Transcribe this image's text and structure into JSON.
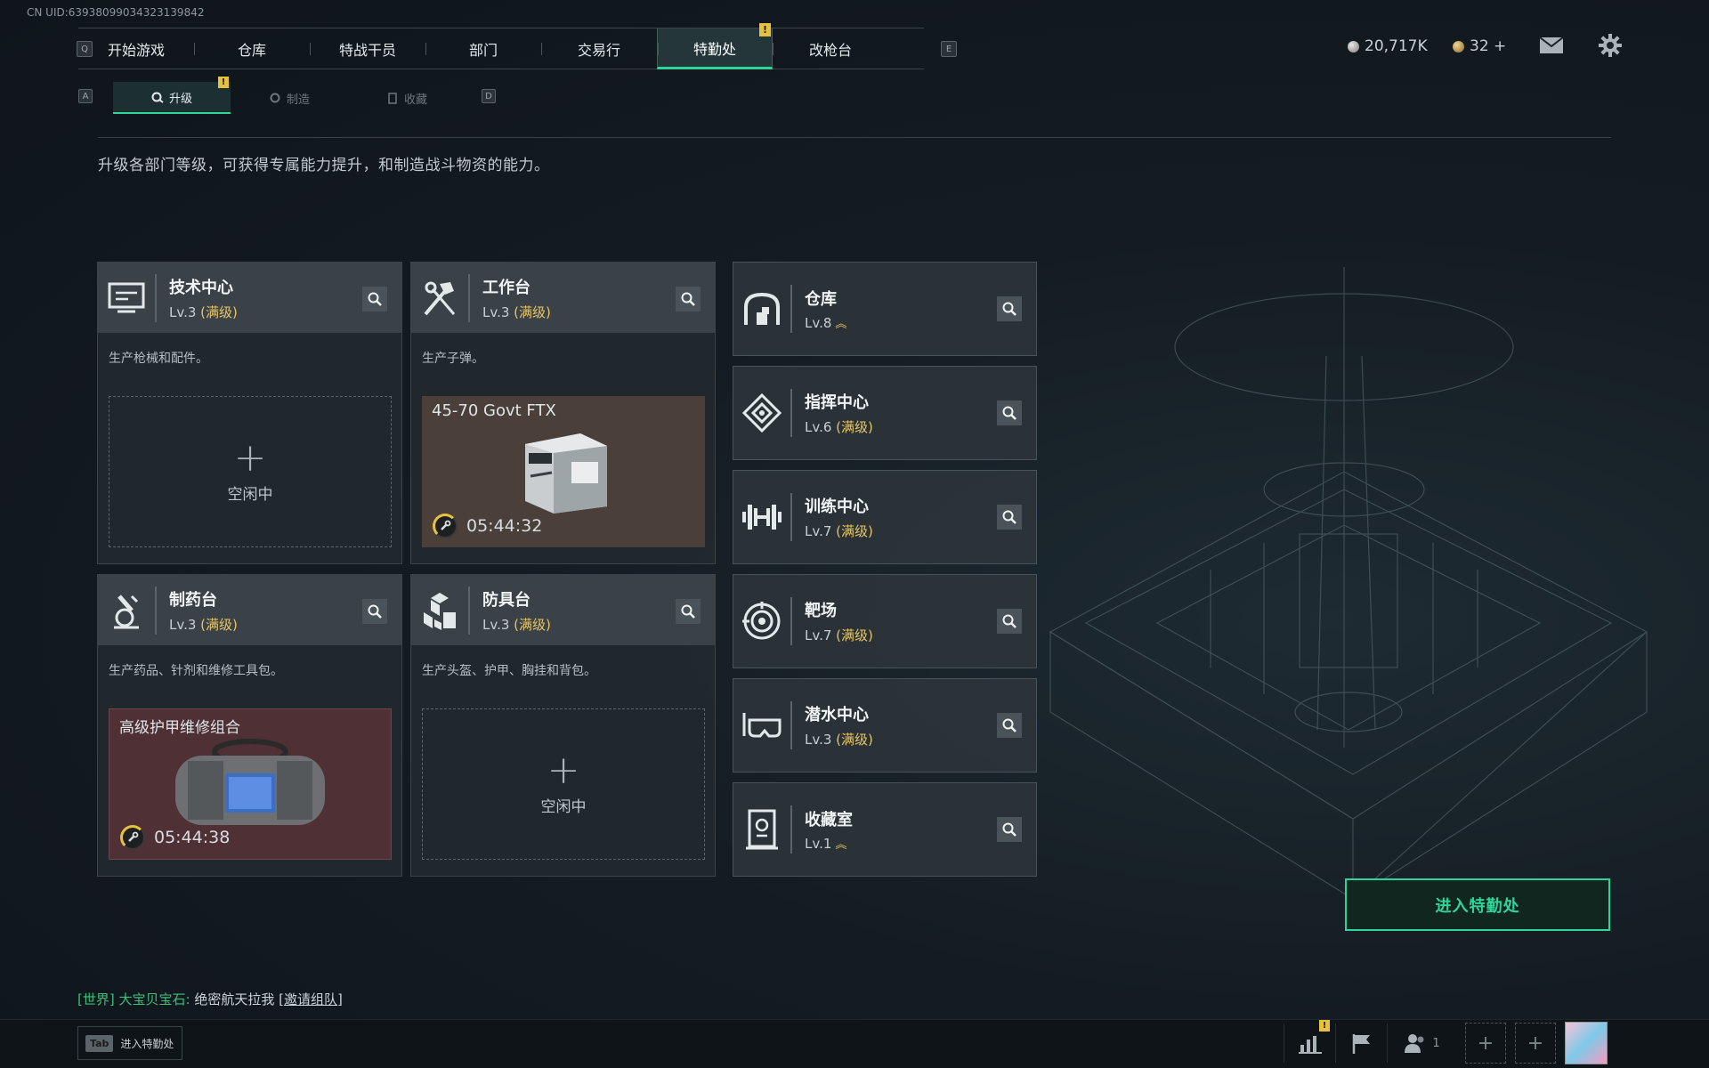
{
  "uid": "CN UID:6393809903432313984​2",
  "nav": {
    "left_key": "Q",
    "right_key": "E",
    "tabs": [
      {
        "label": "开始游戏"
      },
      {
        "label": "仓库"
      },
      {
        "label": "特战干员"
      },
      {
        "label": "部门"
      },
      {
        "label": "交易行"
      },
      {
        "label": "特勤处",
        "active": true,
        "alert": "!"
      },
      {
        "label": "改枪台"
      }
    ]
  },
  "currency": {
    "silver": "20,717K",
    "gold": "32 +"
  },
  "subnav": {
    "left_key": "A",
    "right_key": "D",
    "tabs": [
      {
        "label": "升级",
        "active": true,
        "alert": "!"
      },
      {
        "label": "制造"
      },
      {
        "label": "收藏"
      }
    ]
  },
  "intro": "升级各部门等级，可获得专属能力提升，和制造战斗物资的能力。",
  "workshops": [
    {
      "name": "技术中心",
      "level": "Lv.3",
      "max": "(满级)",
      "desc": "生产枪械和配件。",
      "status": "空闲中",
      "icon": "tech-center-icon"
    },
    {
      "name": "工作台",
      "level": "Lv.3",
      "max": "(满级)",
      "desc": "生产子弹。",
      "item": "45-70 Govt FTX",
      "timer": "05:44:32",
      "icon": "workbench-icon"
    },
    {
      "name": "制药台",
      "level": "Lv.3",
      "max": "(满级)",
      "desc": "生产药品、针剂和维修工具包。",
      "item": "高级护甲维修组合",
      "timer": "05:44:38",
      "icon": "pharmacy-icon"
    },
    {
      "name": "防具台",
      "level": "Lv.3",
      "max": "(满级)",
      "desc": "生产头盔、护甲、胸挂和背包。",
      "status": "空闲中",
      "icon": "armor-bench-icon"
    }
  ],
  "facilities": [
    {
      "name": "仓库",
      "level": "Lv.8",
      "upgradable": true,
      "icon": "warehouse-icon"
    },
    {
      "name": "指挥中心",
      "level": "Lv.6",
      "max": "(满级)",
      "icon": "command-center-icon"
    },
    {
      "name": "训练中心",
      "level": "Lv.7",
      "max": "(满级)",
      "icon": "training-center-icon"
    },
    {
      "name": "靶场",
      "level": "Lv.7",
      "max": "(满级)",
      "icon": "shooting-range-icon"
    },
    {
      "name": "潜水中心",
      "level": "Lv.3",
      "max": "(满级)",
      "icon": "diving-center-icon"
    },
    {
      "name": "收藏室",
      "level": "Lv.1",
      "upgradable": true,
      "icon": "collection-room-icon"
    }
  ],
  "enter_button": "进入特勤处",
  "chat": {
    "channel": "[世界]",
    "user": "大宝贝宝石:",
    "message": "绝密航天拉我",
    "link": "[邀请组队]"
  },
  "bottom": {
    "tab_key": "Tab",
    "tab_label": "进入特勤处",
    "team_count": "1",
    "stats_alert": "!"
  },
  "colors": {
    "accent": "#2fd49b",
    "max_level": "#e7c463",
    "alert": "#e8c23c"
  }
}
